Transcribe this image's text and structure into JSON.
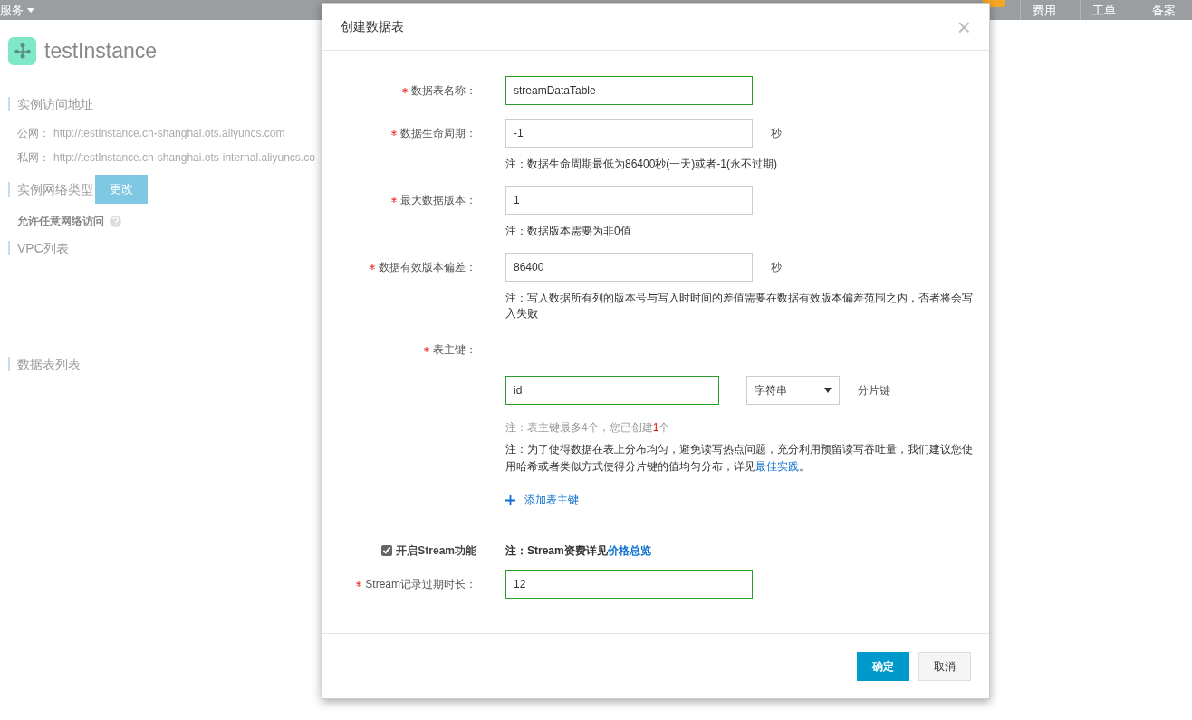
{
  "top_bar": {
    "items": [
      {
        "label": "服务",
        "kind": "dropdown"
      },
      {
        "label": "费用",
        "kind": "link"
      },
      {
        "label": "工单",
        "kind": "link"
      },
      {
        "label": "备案",
        "kind": "link"
      }
    ]
  },
  "instance": {
    "name": "testInstance"
  },
  "sections": [
    {
      "kind": "addresses",
      "title": "实例访问地址",
      "rows": [
        {
          "label": "公网：",
          "value": "http://testInstance.cn-shanghai.ots.aliyuncs.com"
        },
        {
          "label": "私网：",
          "value": "http://testInstance.cn-shanghai.ots-internal.aliyuncs.co"
        }
      ]
    },
    {
      "kind": "network",
      "title": "实例网络类型",
      "button": "更改",
      "value": "允许任意网络访问"
    },
    {
      "kind": "plain",
      "title": "VPC列表"
    },
    {
      "kind": "plain",
      "title": "数据表列表"
    }
  ],
  "dialog": {
    "title": "创建数据表",
    "close": "×",
    "fields": [
      {
        "kind": "input",
        "label": "数据表名称：",
        "required": true,
        "value": "streamDataTable",
        "validated": true
      },
      {
        "kind": "input",
        "label": "数据生命周期：",
        "required": true,
        "value": "-1",
        "validated": false,
        "unit": "秒",
        "note": "注：数据生命周期最低为86400秒(一天)或者-1(永不过期)"
      },
      {
        "kind": "input",
        "label": "最大数据版本：",
        "required": true,
        "value": "1",
        "validated": false,
        "note": "注：数据版本需要为非0值"
      },
      {
        "kind": "input",
        "label": "数据有效版本偏差：",
        "required": true,
        "value": "86400",
        "validated": false,
        "unit": "秒",
        "note": "注：写入数据所有列的版本号与写入时时间的差值需要在数据有效版本偏差范围之内，否者将会写入失败"
      },
      {
        "kind": "primary_key",
        "label": "表主键：",
        "required": true,
        "keys": [
          {
            "value": "id",
            "validated": true,
            "type": "字符串",
            "tag": "分片键"
          }
        ],
        "limit_note_before": "注：表主键最多4个，您已创建",
        "created_count": "1",
        "limit_note_after": "个",
        "advice_note": "注：为了使得数据在表上分布均匀，避免读写热点问题，充分利用预留读写吞吐量，我们建议您使用哈希或者类似方式使得分片键的值均匀分布，详见",
        "advice_link": "最佳实践",
        "advice_end": "。",
        "add_button": "添加表主键"
      },
      {
        "kind": "checkbox",
        "label": "开启Stream功能",
        "checked": true,
        "note": "注：Stream资费详见",
        "link": "价格总览"
      },
      {
        "kind": "input",
        "label": "Stream记录过期时长：",
        "required": true,
        "value": "12",
        "validated": true
      }
    ],
    "buttons": [
      {
        "label": "确定",
        "primary": true
      },
      {
        "label": "取消",
        "primary": false
      }
    ]
  }
}
